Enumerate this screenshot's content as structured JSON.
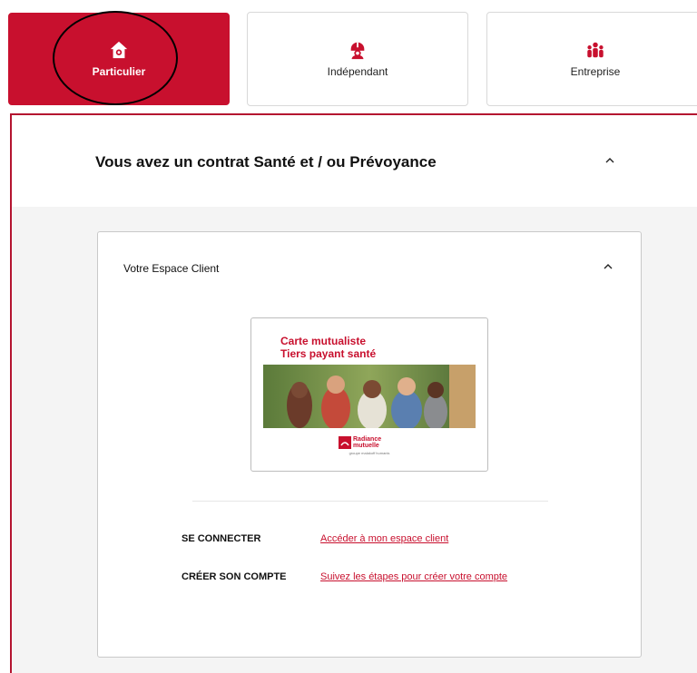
{
  "tabs": [
    {
      "label": "Particulier",
      "icon": "house-icon",
      "active": true
    },
    {
      "label": "Indépendant",
      "icon": "worker-helmet-icon",
      "active": false
    },
    {
      "label": "Entreprise",
      "icon": "group-people-icon",
      "active": false
    }
  ],
  "panel": {
    "title": "Vous avez un contrat Santé et / ou Prévoyance"
  },
  "card": {
    "title": "Votre Espace Client",
    "promo": {
      "line1": "Carte mutualiste",
      "line2": "Tiers payant santé",
      "logo_line1": "Radiance",
      "logo_line2": "mutuelle",
      "logo_line3": "groupe malakoff humanis"
    },
    "rows": [
      {
        "label": "SE CONNECTER",
        "link": "Accéder à mon espace client"
      },
      {
        "label": "CRÉER SON COMPTE",
        "link": "Suivez les étapes pour créer votre compte"
      }
    ]
  },
  "colors": {
    "brand_red": "#c8102e",
    "panel_bg": "#f4f4f4"
  }
}
